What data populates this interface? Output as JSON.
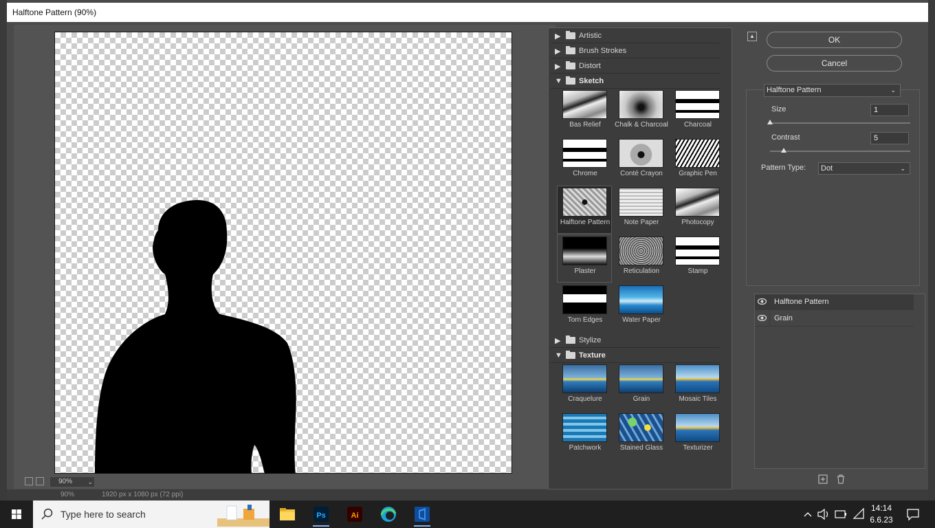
{
  "window": {
    "title": "Halftone Pattern (90%)"
  },
  "preview": {
    "zoom": "90%",
    "status_zoom": "90%",
    "status_dims": "1920 px x 1080 px (72 ppi)"
  },
  "gallery": {
    "categories": [
      {
        "label": "Artistic",
        "open": false
      },
      {
        "label": "Brush Strokes",
        "open": false
      },
      {
        "label": "Distort",
        "open": false
      },
      {
        "label": "Sketch",
        "open": true
      },
      {
        "label": "Stylize",
        "open": false
      },
      {
        "label": "Texture",
        "open": true
      }
    ],
    "sketch_filters": [
      "Bas Relief",
      "Chalk & Charcoal",
      "Charcoal",
      "Chrome",
      "Conté Crayon",
      "Graphic Pen",
      "Halftone Pattern",
      "Note Paper",
      "Photocopy",
      "Plaster",
      "Reticulation",
      "Stamp",
      "Torn Edges",
      "Water Paper"
    ],
    "texture_filters": [
      "Craquelure",
      "Grain",
      "Mosaic Tiles",
      "Patchwork",
      "Stained Glass",
      "Texturizer"
    ],
    "selected": "Halftone Pattern"
  },
  "actions": {
    "ok": "OK",
    "cancel": "Cancel"
  },
  "settings": {
    "filter": "Halftone Pattern",
    "size_label": "Size",
    "size_value": "1",
    "size_level": 0.0,
    "contrast_label": "Contrast",
    "contrast_value": "5",
    "contrast_level": 0.1,
    "pattern_type_label": "Pattern Type:",
    "pattern_type_value": "Dot"
  },
  "layers": [
    {
      "name": "Halftone Pattern",
      "visible": true,
      "active": true
    },
    {
      "name": "Grain",
      "visible": true,
      "active": false
    }
  ],
  "taskbar": {
    "search_placeholder": "Type here to search",
    "apps": [
      "file-explorer",
      "photoshop",
      "illustrator",
      "edge",
      "app-blue"
    ],
    "time": "14:14",
    "date": "6.6.23"
  }
}
